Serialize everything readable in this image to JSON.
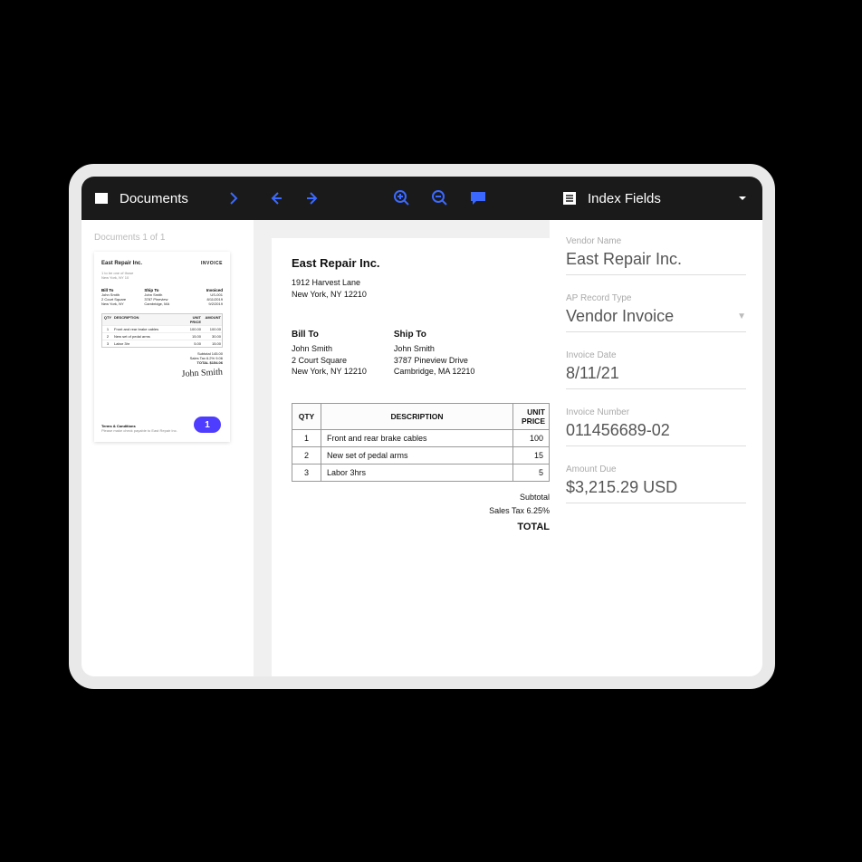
{
  "topbar": {
    "documents_label": "Documents",
    "index_label": "Index Fields"
  },
  "thumbs": {
    "status": "Documents 1 of 1",
    "badge": "1",
    "mini": {
      "company": "East Repair Inc.",
      "invoice_word": "INVOICE",
      "addr1": "1 to be one of those",
      "addr2": "New York, NY 10",
      "billto_h": "Bill To",
      "shipto_h": "Ship To",
      "inv_h": "Invoiced",
      "th_qty": "QTY",
      "th_desc": "DESCRIPTION",
      "th_up": "UNIT PRICE",
      "th_am": "AMOUNT",
      "r1": "Front and rear brake cables",
      "r2": "New set of pedal arms",
      "r3": "Labor 3hr",
      "sub": "Subtotal",
      "tax": "Sales Tax 6.2%",
      "total_l": "TOTAL",
      "total_v": "$154.06",
      "sig": "John Smith",
      "terms_h": "Terms & Conditions",
      "terms_t": "Please make check payable to East Repair Inc."
    }
  },
  "doc": {
    "company": "East Repair Inc.",
    "addr1": "1912 Harvest Lane",
    "addr2": "New York, NY 12210",
    "billto_h": "Bill To",
    "billto_1": "John Smith",
    "billto_2": "2 Court Square",
    "billto_3": "New York, NY 12210",
    "shipto_h": "Ship To",
    "shipto_1": "John Smith",
    "shipto_2": "3787 Pineview Drive",
    "shipto_3": "Cambridge, MA 12210",
    "th_qty": "QTY",
    "th_desc": "DESCRIPTION",
    "th_up": "UNIT PRICE",
    "rows": [
      {
        "qty": "1",
        "desc": "Front and rear brake cables",
        "up": "100"
      },
      {
        "qty": "2",
        "desc": "New set of pedal arms",
        "up": "15"
      },
      {
        "qty": "3",
        "desc": "Labor 3hrs",
        "up": "5"
      }
    ],
    "subtotal": "Subtotal",
    "tax": "Sales Tax 6.25%",
    "total": "TOTAL"
  },
  "fields": {
    "vendor_name_l": "Vendor Name",
    "vendor_name_v": "East Repair Inc.",
    "record_type_l": "AP Record Type",
    "record_type_v": "Vendor Invoice",
    "inv_date_l": "Invoice Date",
    "inv_date_v": "8/11/21",
    "inv_num_l": "Invoice Number",
    "inv_num_v": "011456689-02",
    "amount_l": "Amount Due",
    "amount_v": "$3,215.29 USD"
  }
}
